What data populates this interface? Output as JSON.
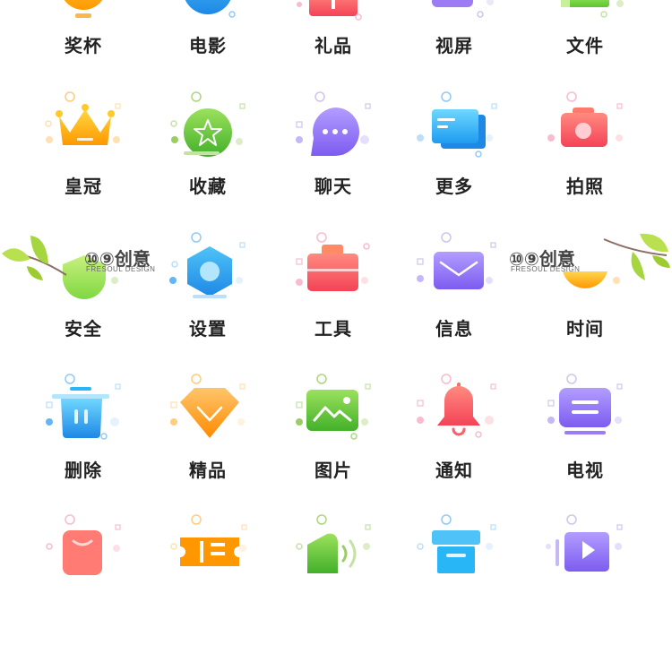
{
  "rows": [
    [
      {
        "label": "奖杯",
        "icon": "trophy-icon"
      },
      {
        "label": "电影",
        "icon": "movie-icon"
      },
      {
        "label": "礼品",
        "icon": "gift-icon"
      },
      {
        "label": "视屏",
        "icon": "video-icon"
      },
      {
        "label": "文件",
        "icon": "file-icon"
      }
    ],
    [
      {
        "label": "皇冠",
        "icon": "crown-icon"
      },
      {
        "label": "收藏",
        "icon": "favorite-star-icon"
      },
      {
        "label": "聊天",
        "icon": "chat-bubble-icon"
      },
      {
        "label": "更多",
        "icon": "cards-icon"
      },
      {
        "label": "拍照",
        "icon": "camera-icon"
      }
    ],
    [
      {
        "label": "安全",
        "icon": "shield-icon"
      },
      {
        "label": "设置",
        "icon": "settings-hexagon-icon"
      },
      {
        "label": "工具",
        "icon": "toolbox-icon"
      },
      {
        "label": "信息",
        "icon": "envelope-icon"
      },
      {
        "label": "时间",
        "icon": "clock-icon"
      }
    ],
    [
      {
        "label": "删除",
        "icon": "trash-icon"
      },
      {
        "label": "精品",
        "icon": "diamond-icon"
      },
      {
        "label": "图片",
        "icon": "image-icon"
      },
      {
        "label": "通知",
        "icon": "bell-icon"
      },
      {
        "label": "电视",
        "icon": "tv-icon"
      }
    ],
    [
      {
        "label": "",
        "icon": "pink-card-icon"
      },
      {
        "label": "",
        "icon": "ticket-icon"
      },
      {
        "label": "",
        "icon": "speaker-icon"
      },
      {
        "label": "",
        "icon": "printer-icon"
      },
      {
        "label": "",
        "icon": "play-video-icon"
      }
    ]
  ],
  "watermark": {
    "brand": "⑩⑨创意",
    "sub": "FRESOUL DESIGN"
  },
  "colors": {
    "orange": "#ffa726",
    "blue": "#29b6f6",
    "red": "#ff5c6c",
    "purple": "#9c7bf5",
    "green": "#6fd13b"
  }
}
